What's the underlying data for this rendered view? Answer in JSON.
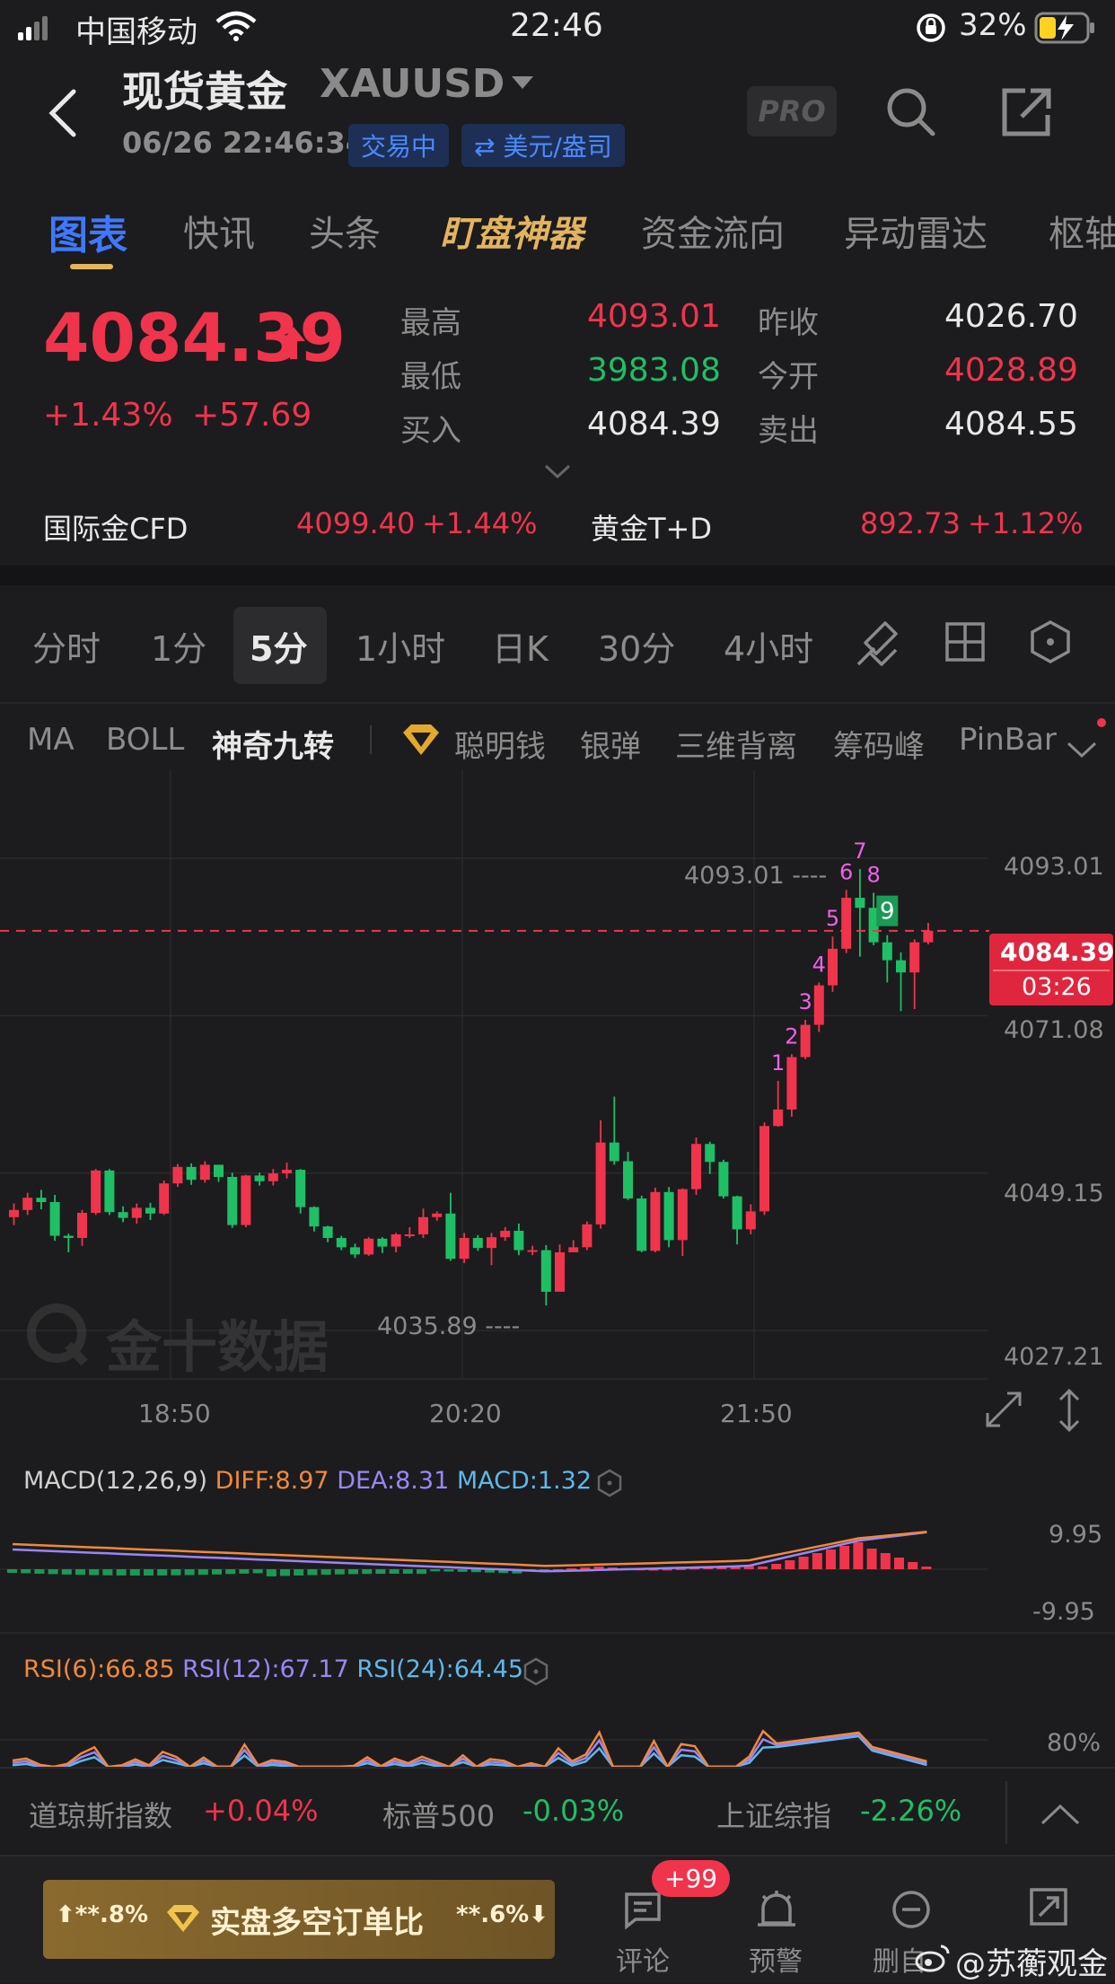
{
  "status_bar": {
    "carrier": "中国移动",
    "time": "22:46",
    "battery": "32%"
  },
  "header": {
    "title": "现货黄金",
    "symbol": "XAUUSD",
    "datetime": "06/26 22:46:34",
    "trading_status": "交易中",
    "unit": "⇄ 美元/盎司",
    "pro_label": "PRO"
  },
  "tabs": [
    "图表",
    "快讯",
    "头条",
    "盯盘神器",
    "资金流向",
    "异动雷达",
    "枢轴"
  ],
  "quote": {
    "price": "4084.39",
    "change_pct": "+1.43%",
    "change_abs": "+57.69",
    "high_label": "最高",
    "high": "4093.01",
    "low_label": "最低",
    "low": "3983.08",
    "bid_label": "买入",
    "bid": "4084.39",
    "prev_close_label": "昨收",
    "prev_close": "4026.70",
    "open_label": "今开",
    "open": "4028.89",
    "ask_label": "卖出",
    "ask": "4084.55",
    "cfd_label": "国际金CFD",
    "cfd_price": "4099.40",
    "cfd_pct": "+1.44%",
    "td_label": "黄金T+D",
    "td_price": "892.73",
    "td_pct": "+1.12%"
  },
  "periods": [
    "分时",
    "1分",
    "5分",
    "1小时",
    "日K",
    "30分",
    "4小时"
  ],
  "indicators": [
    "MA",
    "BOLL",
    "神奇九转",
    "聪明钱",
    "银弹",
    "三维背离",
    "筹码峰",
    "PinBar"
  ],
  "chart": {
    "y_labels": [
      "4093.01",
      "4071.08",
      "4049.15",
      "4027.21"
    ],
    "x_labels": [
      "18:50",
      "20:20",
      "21:50"
    ],
    "current_price": "4084.39",
    "countdown": "03:26",
    "high_mark": "4093.01 ----",
    "low_mark": "4035.89 ----",
    "watermark": "金十数据",
    "td_numbers": [
      "1",
      "2",
      "3",
      "4",
      "5",
      "6",
      "7",
      "8",
      "9"
    ]
  },
  "macd": {
    "title": "MACD(12,26,9)",
    "diff": "DIFF:8.97",
    "dea": "DEA:8.31",
    "macd": "MACD:1.32",
    "y_top": "9.95",
    "y_bottom": "-9.95"
  },
  "rsi": {
    "rsi6": "RSI(6):66.85",
    "rsi12": "RSI(12):67.17",
    "rsi24": "RSI(24):64.45",
    "y_label": "80%"
  },
  "index_bar": [
    {
      "name": "道琼斯指数",
      "value": "+0.04%"
    },
    {
      "name": "标普500",
      "value": "-0.03%"
    },
    {
      "name": "上证综指",
      "value": "-2.26%"
    }
  ],
  "bottom_bar": {
    "left_pct": "⬆**.8%",
    "promo": "实盘多空订单比",
    "right_pct": "**.6%⬇",
    "comment_label": "评论",
    "comment_badge": "+99",
    "alert_label": "预警",
    "third_label": "删自",
    "watermark": "@苏蘅观金"
  },
  "colors": {
    "up": "#f0344c",
    "down": "#1fbf66",
    "accent": "#3f78ff",
    "gold": "#e3b45f"
  },
  "candles": [
    [
      4044.5,
      4045.5,
      4043.4,
      4046.4
    ],
    [
      4045.5,
      4047.2,
      4044.8,
      4047.9
    ],
    [
      4047.2,
      4046.6,
      4045.6,
      4048.3
    ],
    [
      4046.6,
      4041.9,
      4041.2,
      4047.6
    ],
    [
      4041.9,
      4041.6,
      4039.6,
      4042.2
    ],
    [
      4041.6,
      4045.1,
      4040.5,
      4045.5
    ],
    [
      4045.1,
      4051.0,
      4044.8,
      4051.2
    ],
    [
      4051.0,
      4045.2,
      4044.8,
      4051.2
    ],
    [
      4045.2,
      4044.4,
      4043.8,
      4046.0
    ],
    [
      4044.4,
      4045.8,
      4043.6,
      4046.4
    ],
    [
      4045.8,
      4045.0,
      4044.1,
      4046.5
    ],
    [
      4045.0,
      4049.2,
      4044.8,
      4049.6
    ],
    [
      4049.2,
      4051.5,
      4048.7,
      4051.9
    ],
    [
      4051.5,
      4049.7,
      4049.0,
      4052.0
    ],
    [
      4049.7,
      4051.8,
      4049.3,
      4052.3
    ],
    [
      4051.8,
      4050.1,
      4049.4,
      4050.9
    ],
    [
      4050.1,
      4043.4,
      4043.0,
      4050.7
    ],
    [
      4043.4,
      4050.3,
      4043.1,
      4050.4
    ],
    [
      4050.3,
      4049.5,
      4048.9,
      4050.7
    ],
    [
      4049.5,
      4050.6,
      4048.9,
      4051.2
    ],
    [
      4050.6,
      4051.1,
      4049.9,
      4052.1
    ],
    [
      4051.1,
      4045.9,
      4045.0,
      4051.2
    ],
    [
      4045.9,
      4043.2,
      4042.5,
      4046.0
    ],
    [
      4043.2,
      4041.6,
      4041.0,
      4043.3
    ],
    [
      4041.6,
      4040.3,
      4039.9,
      4041.9
    ],
    [
      4040.3,
      4039.3,
      4038.8,
      4040.8
    ],
    [
      4039.3,
      4041.5,
      4039.1,
      4041.7
    ],
    [
      4041.5,
      4040.4,
      4039.5,
      4041.7
    ],
    [
      4040.4,
      4042.1,
      4039.6,
      4042.3
    ],
    [
      4042.1,
      4042.1,
      4041.6,
      4043.1
    ],
    [
      4042.1,
      4044.5,
      4041.6,
      4045.7
    ],
    [
      4044.5,
      4045.0,
      4044.0,
      4045.3
    ],
    [
      4045.0,
      4038.7,
      4038.4,
      4047.9
    ],
    [
      4038.7,
      4041.6,
      4038.1,
      4042.3
    ],
    [
      4041.6,
      4040.2,
      4039.8,
      4042.0
    ],
    [
      4040.2,
      4041.7,
      4037.8,
      4042.3
    ],
    [
      4041.7,
      4042.6,
      4041.2,
      4043.1
    ],
    [
      4042.6,
      4039.9,
      4039.2,
      4043.6
    ],
    [
      4039.9,
      4039.9,
      4039.2,
      4040.5
    ],
    [
      4039.9,
      4034.1,
      4032.2,
      4040.6
    ],
    [
      4034.1,
      4039.6,
      4035.3,
      4040.7
    ],
    [
      4039.6,
      4040.3,
      4039.6,
      4041.3
    ],
    [
      4040.3,
      4043.5,
      4039.9,
      4043.9
    ],
    [
      4043.5,
      4054.9,
      4042.9,
      4058.0
    ],
    [
      4054.9,
      4052.3,
      4051.8,
      4061.3
    ],
    [
      4052.3,
      4047.1,
      4046.9,
      4053.6
    ],
    [
      4047.1,
      4039.8,
      4039.6,
      4047.5
    ],
    [
      4039.8,
      4048.0,
      4039.6,
      4048.6
    ],
    [
      4048.0,
      4041.3,
      4040.3,
      4048.7
    ],
    [
      4041.3,
      4048.4,
      4039.1,
      4048.5
    ],
    [
      4048.4,
      4054.7,
      4047.6,
      4055.6
    ],
    [
      4054.7,
      4052.2,
      4050.5,
      4055.0
    ],
    [
      4052.2,
      4047.4,
      4047.1,
      4052.5
    ],
    [
      4047.4,
      4042.8,
      4040.7,
      4047.5
    ],
    [
      4042.8,
      4045.3,
      4042.1,
      4046.3
    ],
    [
      4045.3,
      4057.2,
      4044.8,
      4057.7
    ],
    [
      4057.2,
      4059.5,
      4057.1,
      4063.5
    ],
    [
      4059.5,
      4066.8,
      4058.5,
      4067.2
    ],
    [
      4066.8,
      4071.3,
      4066.5,
      4072.0
    ],
    [
      4071.3,
      4076.8,
      4070.3,
      4077.2
    ],
    [
      4076.8,
      4081.9,
      4075.9,
      4083.6
    ],
    [
      4081.9,
      4089.0,
      4081.3,
      4090.1
    ],
    [
      4089.0,
      4087.6,
      4080.8,
      4093.0
    ],
    [
      4087.6,
      4082.8,
      4082.4,
      4089.7
    ],
    [
      4082.8,
      4080.3,
      4077.2,
      4083.8
    ],
    [
      4080.3,
      4078.6,
      4073.2,
      4081.4
    ],
    [
      4078.6,
      4082.8,
      4073.5,
      4083.2
    ],
    [
      4082.8,
      4084.4,
      4082.5,
      4085.5
    ]
  ]
}
